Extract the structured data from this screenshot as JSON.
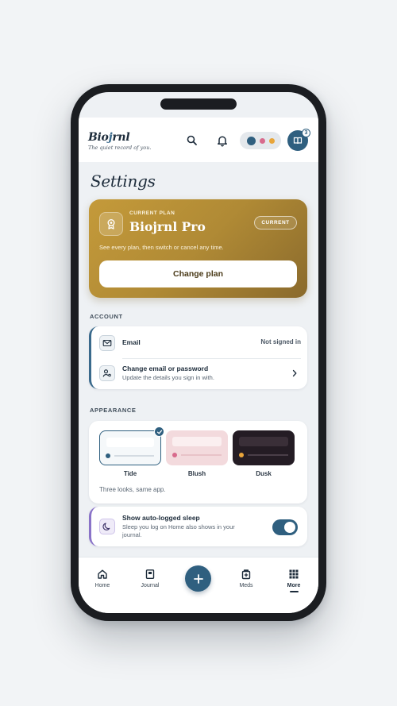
{
  "app": {
    "name_prefix": "Bio",
    "name_accent": "j",
    "name_suffix": "rnl",
    "tagline": "The quiet record of you.",
    "journal_badge_count": "3"
  },
  "header_theme_dots": [
    "#2f5f7f",
    "#d86a8c",
    "#e8a53a"
  ],
  "page": {
    "title": "Settings"
  },
  "plan": {
    "eyebrow": "CURRENT PLAN",
    "name": "Biojrnl Pro",
    "status": "CURRENT",
    "description": "See every plan, then switch or cancel any time.",
    "button_label": "Change plan"
  },
  "account": {
    "section_label": "ACCOUNT",
    "email": {
      "label": "Email",
      "value": "Not signed in"
    },
    "change": {
      "label": "Change email or password",
      "subtitle": "Update the details you sign in with."
    }
  },
  "appearance": {
    "section_label": "APPEARANCE",
    "themes": [
      {
        "label": "Tide",
        "selected": true
      },
      {
        "label": "Blush",
        "selected": false
      },
      {
        "label": "Dusk",
        "selected": false
      }
    ],
    "caption": "Three looks, same app."
  },
  "sleep": {
    "label": "Show auto-logged sleep",
    "subtitle_line1": "Sleep you log on Home also shows in your",
    "subtitle_line2": "journal.",
    "enabled": true
  },
  "nav": {
    "items": [
      {
        "label": "Home",
        "icon": "home-icon"
      },
      {
        "label": "Journal",
        "icon": "book-icon"
      },
      {
        "label": "Meds",
        "icon": "meds-icon"
      },
      {
        "label": "More",
        "icon": "grid-icon",
        "active": true
      }
    ],
    "fab_icon": "plus-icon"
  },
  "colors": {
    "primary": "#2f5f7f",
    "gold": "#b08a35",
    "purple_accent": "#8a73c8"
  }
}
